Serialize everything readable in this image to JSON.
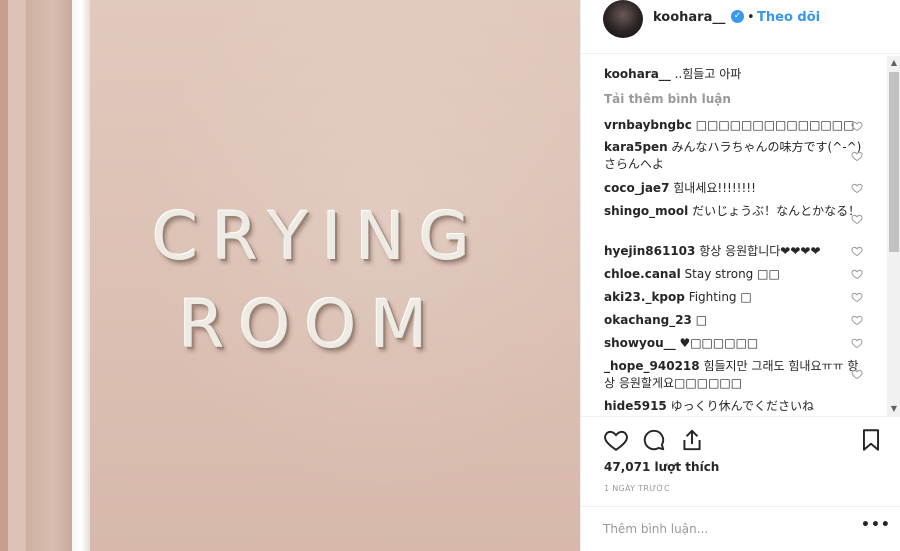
{
  "post": {
    "image": {
      "sign_line_1": "CRYING",
      "sign_line_2": "ROOM"
    }
  },
  "header": {
    "username": "koohara__",
    "verified_icon": "verified-badge-icon",
    "dot": "•",
    "follow_label": "Theo dõi"
  },
  "caption": {
    "username": "koohara__",
    "text": "..힘들고 아파"
  },
  "load_more_label": "Tải thêm bình luận",
  "comments": [
    {
      "user": "vrnbaybngbc",
      "text": "□□□□□□□□□□□□□□"
    },
    {
      "user": "kara5pen",
      "text": "みんなハラちゃんの味方です(^-^)さらんへよ"
    },
    {
      "user": "coco_jae7",
      "text": "힘내세요!!!!!!!!"
    },
    {
      "user": "shingo_mool",
      "text": "だいじょうぶ！なんとかなる！"
    },
    {
      "user": "hyejin861103",
      "text": "항상 응원합니다❤❤❤❤"
    },
    {
      "user": "chloe.canal",
      "text": "Stay strong □□"
    },
    {
      "user": "aki23._kpop",
      "text": "Fighting □"
    },
    {
      "user": "okachang_23",
      "text": "□"
    },
    {
      "user": "showyou__",
      "text": "♥□□□□□□"
    },
    {
      "user": "_hope_940218",
      "text": "힘들지만 그래도 힘내요ㅠㅠ 항상 응원할게요□□□□□□"
    },
    {
      "user": "hide5915",
      "text": "ゆっくり休んでくださいね"
    }
  ],
  "actions": {
    "like_icon": "heart-icon",
    "comment_icon": "comment-icon",
    "share_icon": "share-icon",
    "save_icon": "bookmark-icon",
    "likes_text": "47,071 lượt thích",
    "time_text": "1 NGÀY TRƯỚC"
  },
  "add_comment": {
    "placeholder": "Thêm bình luận...",
    "more_label": "•••"
  },
  "colors": {
    "accent": "#3897f0",
    "text": "#262626",
    "muted": "#999999"
  }
}
